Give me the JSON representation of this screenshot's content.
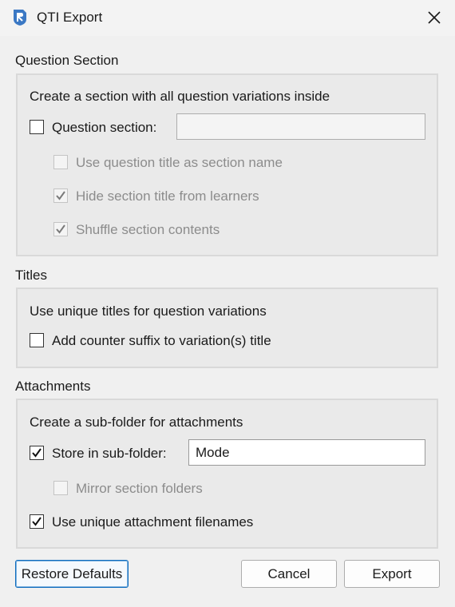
{
  "window": {
    "title": "QTI Export"
  },
  "question_section": {
    "heading": "Question Section",
    "description": "Create a section with all question variations inside",
    "question_section_checkbox": {
      "label": "Question section:",
      "checked": false
    },
    "question_section_input": {
      "value": "",
      "enabled": false
    },
    "use_title_checkbox": {
      "label": "Use question title as section name",
      "checked": false,
      "enabled": false
    },
    "hide_title_checkbox": {
      "label": "Hide section title from learners",
      "checked": true,
      "enabled": false
    },
    "shuffle_checkbox": {
      "label": "Shuffle section contents",
      "checked": true,
      "enabled": false
    }
  },
  "titles": {
    "heading": "Titles",
    "description": "Use unique titles for question variations",
    "counter_suffix_checkbox": {
      "label": "Add counter suffix to variation(s) title",
      "checked": false
    }
  },
  "attachments": {
    "heading": "Attachments",
    "description": "Create a sub-folder for attachments",
    "store_subfolder_checkbox": {
      "label": "Store in sub-folder:",
      "checked": true
    },
    "subfolder_input": {
      "value": "Mode"
    },
    "mirror_folders_checkbox": {
      "label": "Mirror section folders",
      "checked": false,
      "enabled": false
    },
    "unique_filenames_checkbox": {
      "label": "Use unique attachment filenames",
      "checked": true
    }
  },
  "buttons": {
    "restore_defaults": "Restore Defaults",
    "cancel": "Cancel",
    "export": "Export"
  },
  "colors": {
    "background": "#f0f0f0",
    "group_fill": "#eaeaea",
    "disabled_text": "#8c8c8c",
    "default_button_border": "#0f6cbd"
  }
}
